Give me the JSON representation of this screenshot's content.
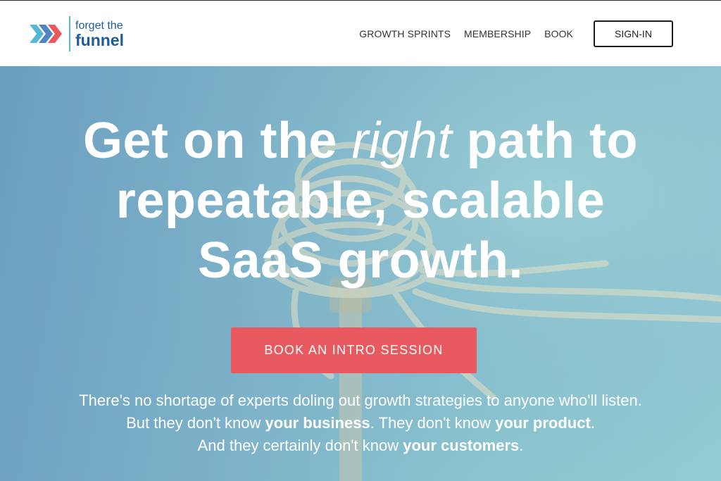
{
  "brand": {
    "logo_small": "forget the",
    "logo_big": "funnel",
    "colors": {
      "chevron_teal": "#5ab7d4",
      "chevron_blue": "#4f86c6",
      "chevron_red": "#e85a5f",
      "logo_text": "#1e5c9a"
    }
  },
  "nav": {
    "items": [
      {
        "label": "GROWTH SPRINTS"
      },
      {
        "label": "MEMBERSHIP"
      },
      {
        "label": "BOOK"
      }
    ],
    "signin_label": "SIGN-IN"
  },
  "hero": {
    "headline": {
      "line1_a": "Get on the ",
      "line1_em": "right",
      "line1_b": " path to",
      "line2": "repeatable, scalable",
      "line3": "SaaS growth."
    },
    "cta_label": "BOOK AN INTRO SESSION",
    "cta_color": "#e85a5f",
    "copy": {
      "line1": "There's no shortage of experts doling out growth strategies to anyone who'll listen.",
      "line2_a": "But they don't know ",
      "line2_b1": "your business",
      "line2_c": ". They don't know ",
      "line2_b2": "your product",
      "line2_d": ".",
      "line3_a": "And they certainly don't know ",
      "line3_b": "your customers",
      "line3_c": "."
    }
  }
}
